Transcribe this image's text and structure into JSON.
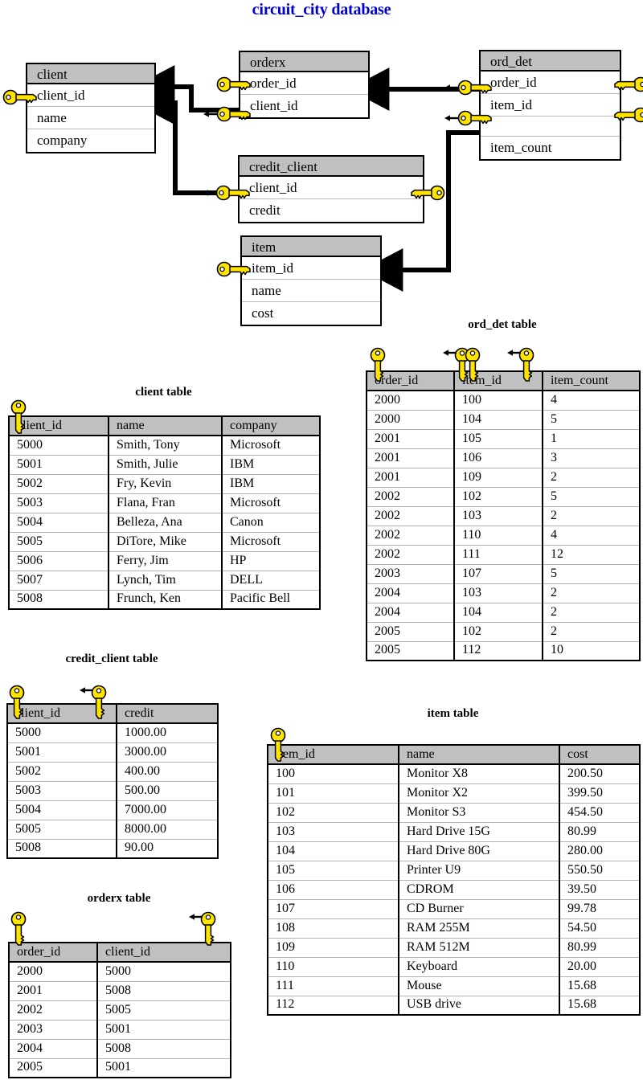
{
  "title": "circuit_city database",
  "diagram": {
    "entities": [
      {
        "id": "client",
        "name": "client",
        "fields": [
          "client_id",
          "name",
          "company"
        ]
      },
      {
        "id": "orderx",
        "name": "orderx",
        "fields": [
          "order_id",
          "client_id"
        ]
      },
      {
        "id": "ord_det",
        "name": "ord_det",
        "fields": [
          "order_id",
          "item_id",
          "item_count"
        ]
      },
      {
        "id": "credit_client",
        "name": "credit_client",
        "fields": [
          "client_id",
          "credit"
        ]
      },
      {
        "id": "item",
        "name": "item",
        "fields": [
          "item_id",
          "name",
          "cost"
        ]
      }
    ],
    "relationships": [
      "ord_det.order_id -> orderx.order_id",
      "ord_det.item_id -> item.item_id",
      "orderx.client_id -> client.client_id",
      "credit_client.client_id -> client.client_id"
    ]
  },
  "tables": [
    {
      "id": "client",
      "caption": "client table",
      "columns": [
        "client_id",
        "name",
        "company"
      ],
      "rows": [
        [
          "5000",
          "Smith, Tony",
          "Microsoft"
        ],
        [
          "5001",
          "Smith, Julie",
          "IBM"
        ],
        [
          "5002",
          "Fry, Kevin",
          "IBM"
        ],
        [
          "5003",
          "Flana, Fran",
          "Microsoft"
        ],
        [
          "5004",
          "Belleza, Ana",
          "Canon"
        ],
        [
          "5005",
          "DiTore, Mike",
          "Microsoft"
        ],
        [
          "5006",
          "Ferry, Jim",
          "HP"
        ],
        [
          "5007",
          "Lynch, Tim",
          "DELL"
        ],
        [
          "5008",
          "Frunch, Ken",
          "Pacific Bell"
        ]
      ]
    },
    {
      "id": "ord_det",
      "caption": "ord_det table",
      "columns": [
        "order_id",
        "item_id",
        "item_count"
      ],
      "rows": [
        [
          "2000",
          "100",
          "4"
        ],
        [
          "2000",
          "104",
          "5"
        ],
        [
          "2001",
          "105",
          "1"
        ],
        [
          "2001",
          "106",
          "3"
        ],
        [
          "2001",
          "109",
          "2"
        ],
        [
          "2002",
          "102",
          "5"
        ],
        [
          "2002",
          "103",
          "2"
        ],
        [
          "2002",
          "110",
          "4"
        ],
        [
          "2002",
          "111",
          "12"
        ],
        [
          "2003",
          "107",
          "5"
        ],
        [
          "2004",
          "103",
          "2"
        ],
        [
          "2004",
          "104",
          "2"
        ],
        [
          "2005",
          "102",
          "2"
        ],
        [
          "2005",
          "112",
          "10"
        ]
      ]
    },
    {
      "id": "credit_client",
      "caption": "credit_client table",
      "columns": [
        "client_id",
        "credit"
      ],
      "rows": [
        [
          "5000",
          "1000.00"
        ],
        [
          "5001",
          "3000.00"
        ],
        [
          "5002",
          "400.00"
        ],
        [
          "5003",
          "500.00"
        ],
        [
          "5004",
          "7000.00"
        ],
        [
          "5005",
          "8000.00"
        ],
        [
          "5008",
          "90.00"
        ]
      ]
    },
    {
      "id": "item",
      "caption": "item table",
      "columns": [
        "item_id",
        "name",
        "cost"
      ],
      "rows": [
        [
          "100",
          "Monitor X8",
          "200.50"
        ],
        [
          "101",
          "Monitor X2",
          "399.50"
        ],
        [
          "102",
          "Monitor S3",
          "454.50"
        ],
        [
          "103",
          "Hard Drive 15G",
          "80.99"
        ],
        [
          "104",
          "Hard Drive 80G",
          "280.00"
        ],
        [
          "105",
          "Printer U9",
          "550.50"
        ],
        [
          "106",
          "CDROM",
          "39.50"
        ],
        [
          "107",
          "CD Burner",
          "99.78"
        ],
        [
          "108",
          "RAM 255M",
          "54.50"
        ],
        [
          "109",
          "RAM 512M",
          "80.99"
        ],
        [
          "110",
          "Keyboard",
          "20.00"
        ],
        [
          "111",
          "Mouse",
          "15.68"
        ],
        [
          "112",
          "USB drive",
          "15.68"
        ]
      ]
    },
    {
      "id": "orderx",
      "caption": "orderx table",
      "columns": [
        "order_id",
        "client_id"
      ],
      "rows": [
        [
          "2000",
          "5000"
        ],
        [
          "2001",
          "5008"
        ],
        [
          "2002",
          "5005"
        ],
        [
          "2003",
          "5001"
        ],
        [
          "2004",
          "5008"
        ],
        [
          "2005",
          "5001"
        ]
      ]
    }
  ],
  "icons": {
    "primary_key": "key-icon",
    "foreign_key": "key-arrow-icon"
  },
  "colors": {
    "title": "#0000cc",
    "header_fill": "#c0c0c0",
    "key_yellow": "#ffe400",
    "key_outline": "#000000",
    "line": "#000000",
    "background": "#ffffff"
  }
}
